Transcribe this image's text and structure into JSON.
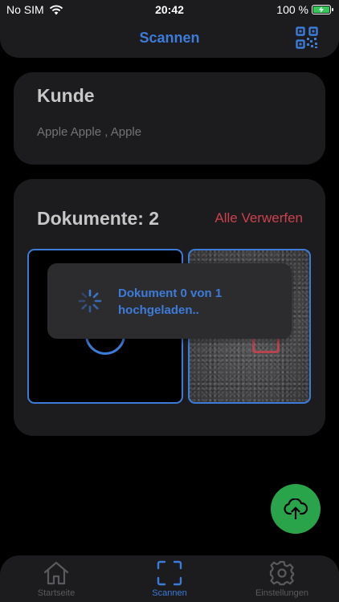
{
  "status_bar": {
    "carrier": "No SIM",
    "time": "20:42",
    "battery": "100 %"
  },
  "header": {
    "title": "Scannen",
    "qr_icon": "qr-code-icon"
  },
  "customer": {
    "title": "Kunde",
    "name": "Apple Apple , Apple"
  },
  "documents": {
    "title": "Dokumente: 2",
    "discard_label": "Alle Verwerfen"
  },
  "toast": {
    "line1": "Dokument 0 von 1",
    "line2": "hochgeladen.."
  },
  "fab": {
    "icon": "cloud-upload-icon",
    "color": "#2aa44a"
  },
  "tabs": [
    {
      "label": "Startseite",
      "icon": "home-icon",
      "active": false
    },
    {
      "label": "Scannen",
      "icon": "scan-icon",
      "active": true
    },
    {
      "label": "Einstellungen",
      "icon": "gear-icon",
      "active": false
    }
  ],
  "colors": {
    "accent": "#3d7bd8",
    "danger": "#c9424d",
    "card": "#1c1c1e"
  }
}
